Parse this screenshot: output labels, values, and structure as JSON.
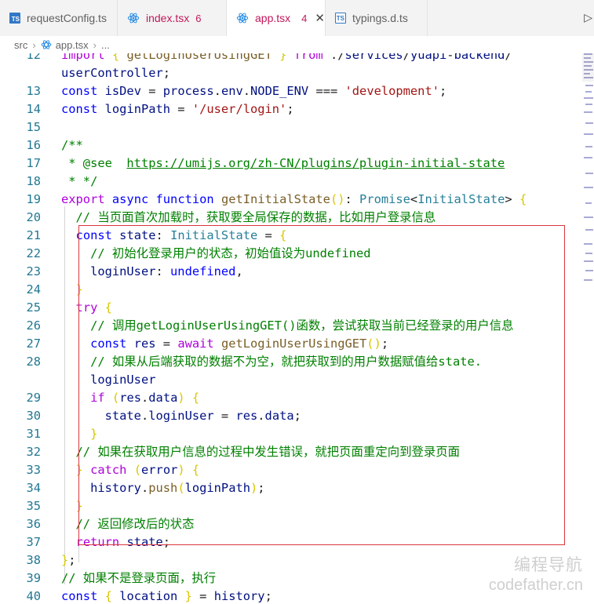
{
  "tabs": [
    {
      "label": "requestConfig.ts",
      "icon": "ts-file-icon",
      "badge": "",
      "active": false
    },
    {
      "label": "index.tsx",
      "icon": "react-file-icon",
      "badge": "6",
      "active": false
    },
    {
      "label": "app.tsx",
      "icon": "react-file-icon",
      "badge": "4",
      "active": true
    },
    {
      "label": "typings.d.ts",
      "icon": "ts-file-icon",
      "badge": "",
      "active": false
    }
  ],
  "breadcrumb": {
    "folder": "src",
    "file": "app.tsx",
    "more": "..."
  },
  "watermark": {
    "title": "编程导航",
    "site": "codefather.cn"
  },
  "colors": {
    "highlight_box": "#d9363e",
    "active_tab_text": "#c2185b"
  },
  "code_lines": [
    {
      "n": "12",
      "text": "import { getLoginUserUsingGET } from './services/yuapi-backend/"
    },
    {
      "n": "",
      "text": "userController';"
    },
    {
      "n": "13",
      "text": "const isDev = process.env.NODE_ENV === 'development';"
    },
    {
      "n": "14",
      "text": "const loginPath = '/user/login';"
    },
    {
      "n": "15",
      "text": ""
    },
    {
      "n": "16",
      "text": "/**"
    },
    {
      "n": "17",
      "text": " * @see  https://umijs.org/zh-CN/plugins/plugin-initial-state"
    },
    {
      "n": "18",
      "text": " * */"
    },
    {
      "n": "19",
      "text": "export async function getInitialState(): Promise<InitialState> {"
    },
    {
      "n": "20",
      "text": "  // 当页面首次加载时，获取要全局保存的数据，比如用户登录信息"
    },
    {
      "n": "21",
      "text": "  const state: InitialState = {"
    },
    {
      "n": "22",
      "text": "    // 初始化登录用户的状态，初始值设为undefined"
    },
    {
      "n": "23",
      "text": "    loginUser: undefined,"
    },
    {
      "n": "24",
      "text": "  }"
    },
    {
      "n": "25",
      "text": "  try {"
    },
    {
      "n": "26",
      "text": "    // 调用getLoginUserUsingGET()函数，尝试获取当前已经登录的用户信息"
    },
    {
      "n": "27",
      "text": "    const res = await getLoginUserUsingGET();"
    },
    {
      "n": "28",
      "text": "    // 如果从后端获取的数据不为空，就把获取到的用户数据赋值给state."
    },
    {
      "n": "",
      "text": "    loginUser"
    },
    {
      "n": "29",
      "text": "    if (res.data) {"
    },
    {
      "n": "30",
      "text": "      state.loginUser = res.data;"
    },
    {
      "n": "31",
      "text": "    }"
    },
    {
      "n": "32",
      "text": "  // 如果在获取用户信息的过程中发生错误，就把页面重定向到登录页面"
    },
    {
      "n": "33",
      "text": "  } catch (error) {"
    },
    {
      "n": "34",
      "text": "    history.push(loginPath);"
    },
    {
      "n": "35",
      "text": "  }"
    },
    {
      "n": "36",
      "text": "  // 返回修改后的状态"
    },
    {
      "n": "37",
      "text": "  return state;"
    },
    {
      "n": "38",
      "text": "};"
    },
    {
      "n": "39",
      "text": "// 如果不是登录页面，执行"
    },
    {
      "n": "40",
      "text": "const { location } = history;"
    }
  ]
}
